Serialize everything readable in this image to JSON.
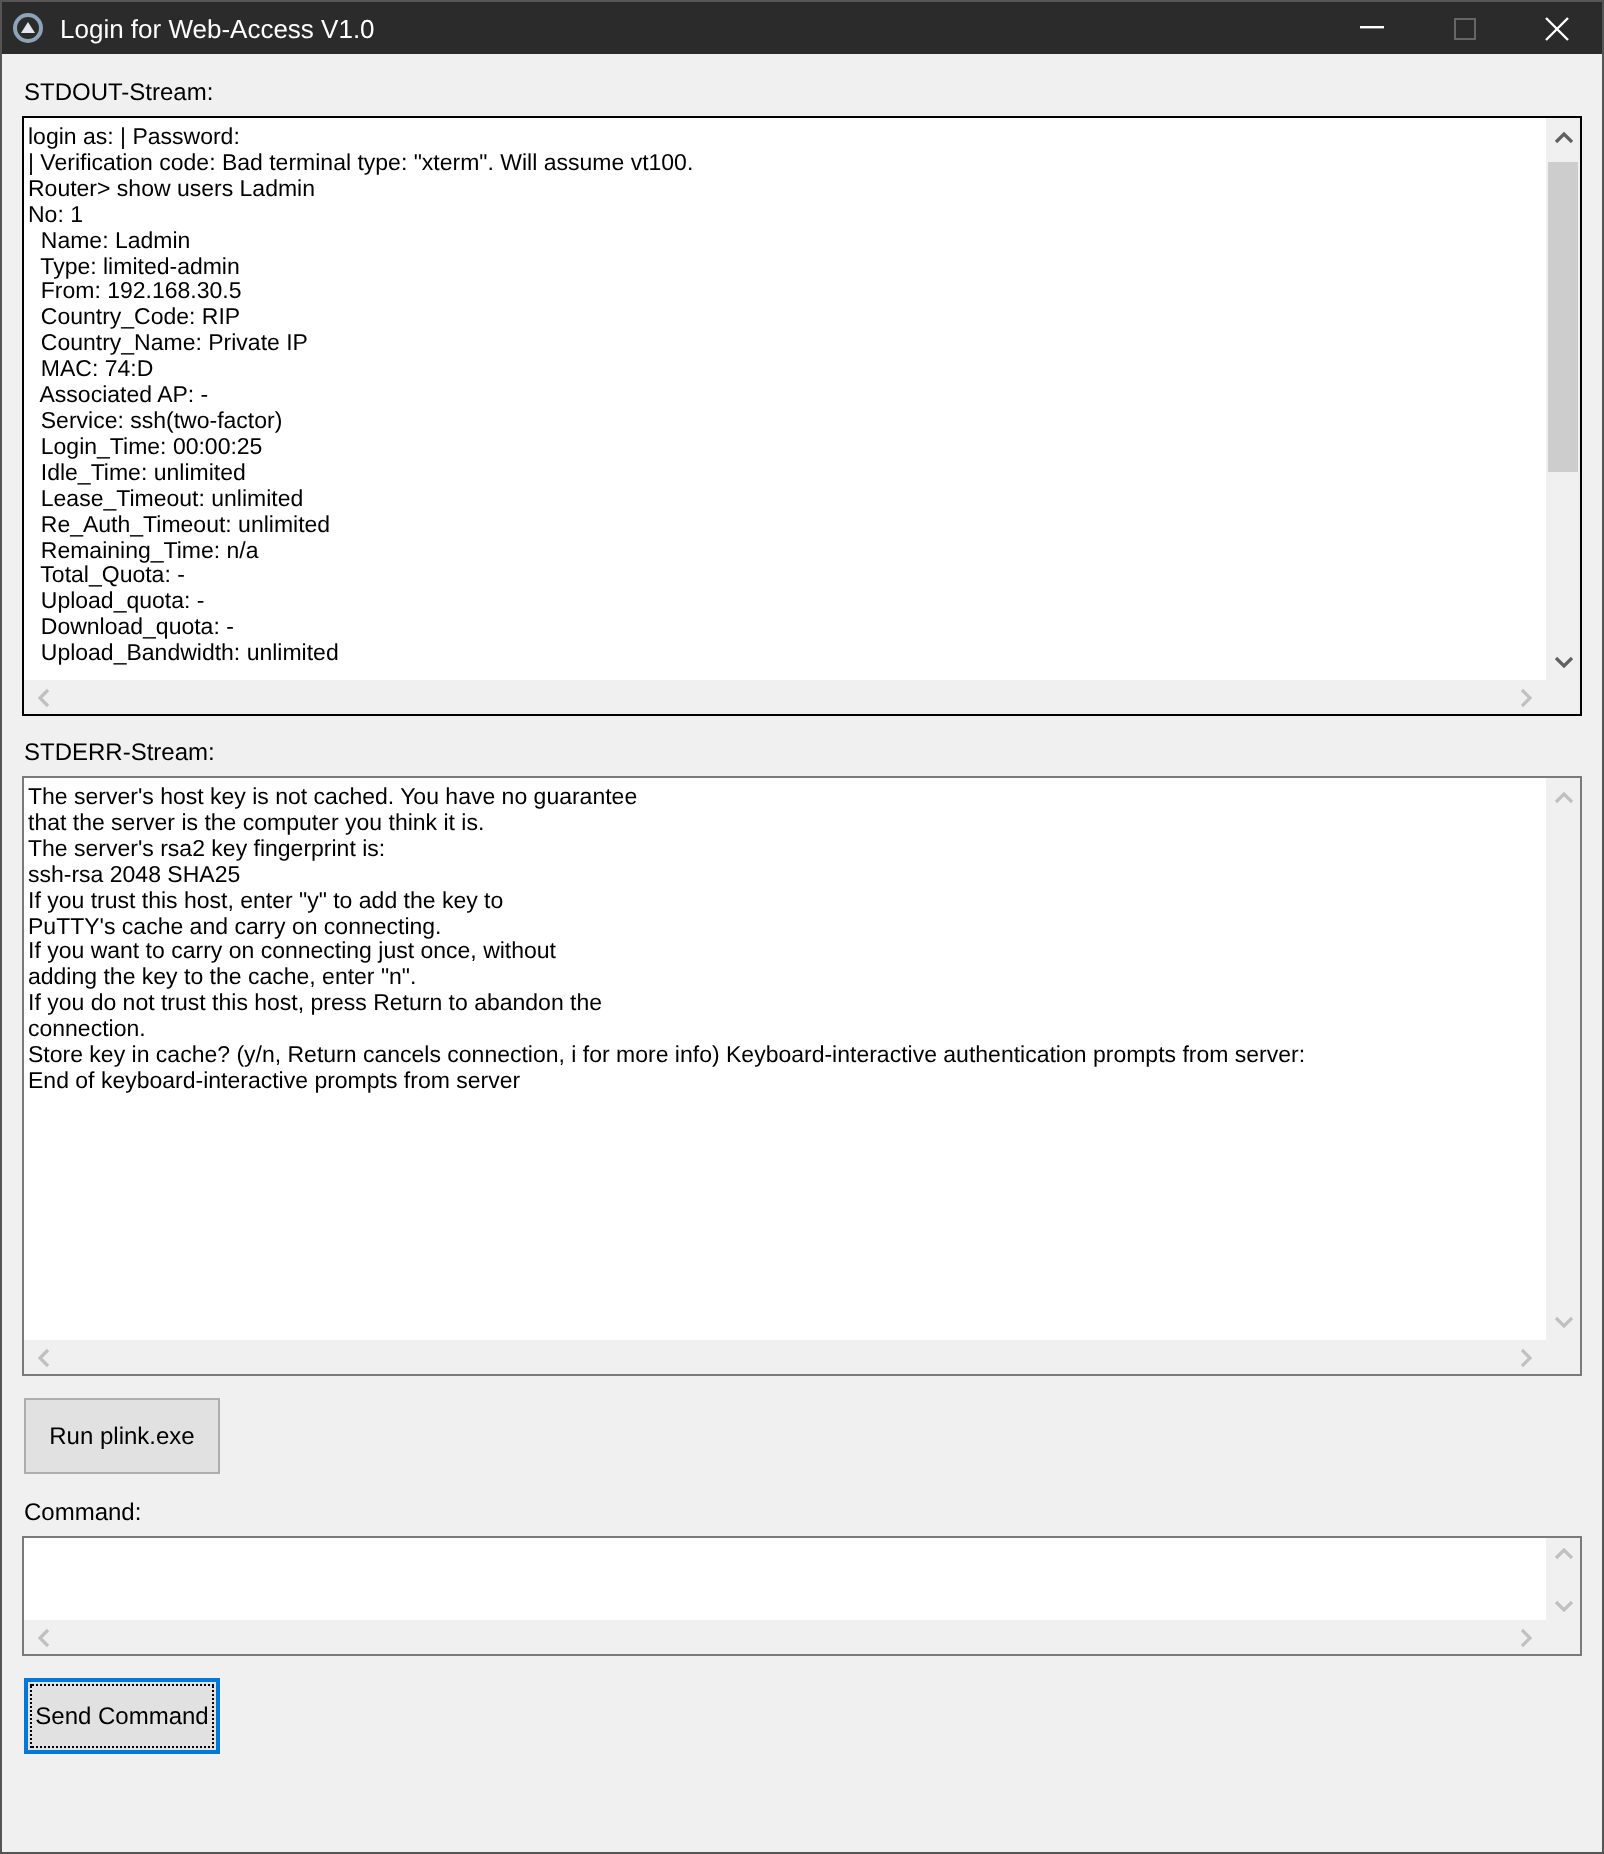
{
  "window": {
    "title": "Login for Web-Access V1.0",
    "maximize_disabled": true
  },
  "stdout": {
    "label": "STDOUT-Stream:",
    "lines": [
      "login as: | Password:",
      "| Verification code: Bad terminal type: \"xterm\". Will assume vt100.",
      "Router> show users Ladmin",
      "No: 1",
      "  Name: Ladmin",
      "  Type: limited-admin",
      "  From: 192.168.30.5",
      "  Country_Code: RIP",
      "  Country_Name: Private IP",
      "  MAC: 74:D",
      "  Associated AP: -",
      "  Service: ssh(two-factor)",
      "  Login_Time: 00:00:25",
      "  Idle_Time: unlimited",
      "  Lease_Timeout: unlimited",
      "  Re_Auth_Timeout: unlimited",
      "  Remaining_Time: n/a",
      "  Total_Quota: -",
      "  Upload_quota: -",
      "  Download_quota: -",
      "  Upload_Bandwidth: unlimited"
    ]
  },
  "stderr": {
    "label": "STDERR-Stream:",
    "lines": [
      "The server's host key is not cached. You have no guarantee",
      "that the server is the computer you think it is.",
      "The server's rsa2 key fingerprint is:",
      "ssh-rsa 2048 SHA25",
      "If you trust this host, enter \"y\" to add the key to",
      "PuTTY's cache and carry on connecting.",
      "If you want to carry on connecting just once, without",
      "adding the key to the cache, enter \"n\".",
      "If you do not trust this host, press Return to abandon the",
      "connection.",
      "Store key in cache? (y/n, Return cancels connection, i for more info) Keyboard-interactive authentication prompts from server:",
      "End of keyboard-interactive prompts from server"
    ]
  },
  "run_button": {
    "label": "Run plink.exe",
    "focused": false
  },
  "command": {
    "label": "Command:"
  },
  "send_button": {
    "label": "Send Command",
    "focused": true
  }
}
